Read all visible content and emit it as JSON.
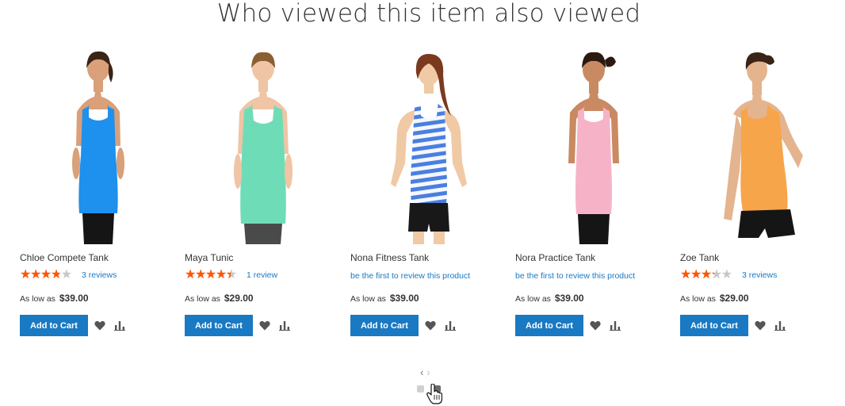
{
  "heading": "Who viewed this item also viewed",
  "products": [
    {
      "name": "Chloe Compete Tank",
      "rating_fraction": 0.7,
      "reviews": "3 reviews",
      "price_prefix": "As low as",
      "price": "$39.00",
      "cart_label": "Add to Cart",
      "shirt_color": "#1e90ee",
      "shorts_color": "#151515"
    },
    {
      "name": "Maya Tunic",
      "rating_fraction": 0.8,
      "reviews": "1 review",
      "price_prefix": "As low as",
      "price": "$29.00",
      "cart_label": "Add to Cart",
      "shirt_color": "#6fdcb8",
      "shorts_color": "#4a4a4a"
    },
    {
      "name": "Nona Fitness Tank",
      "rating_fraction": 0,
      "first_review": "be the first to review this product",
      "price_prefix": "As low as",
      "price": "$39.00",
      "cart_label": "Add to Cart",
      "shirt_color": "#4a7fe0",
      "shorts_color": "#181818"
    },
    {
      "name": "Nora Practice Tank",
      "rating_fraction": 0,
      "first_review": "be the first to review this product",
      "price_prefix": "As low as",
      "price": "$39.00",
      "cart_label": "Add to Cart",
      "shirt_color": "#f6b3c8",
      "shorts_color": "#151515"
    },
    {
      "name": "Zoe Tank",
      "rating_fraction": 0.6,
      "reviews": "3 reviews",
      "price_prefix": "As low as",
      "price": "$29.00",
      "cart_label": "Add to Cart",
      "shirt_color": "#f6a54a",
      "shorts_color": "#151515"
    }
  ],
  "nav": {
    "prev": "‹",
    "next": "›"
  },
  "pager": {
    "pages": 2,
    "active": 2
  },
  "colors": {
    "accent": "#1979c3",
    "star": "#ff5501",
    "star_empty": "#c7c7c7",
    "dot_active": "#6b6b6b",
    "dot_inactive": "#d0d0d0"
  },
  "icons": {
    "wishlist": "heart-icon",
    "compare": "compare-icon",
    "cursor": "hand-pointer-icon"
  }
}
